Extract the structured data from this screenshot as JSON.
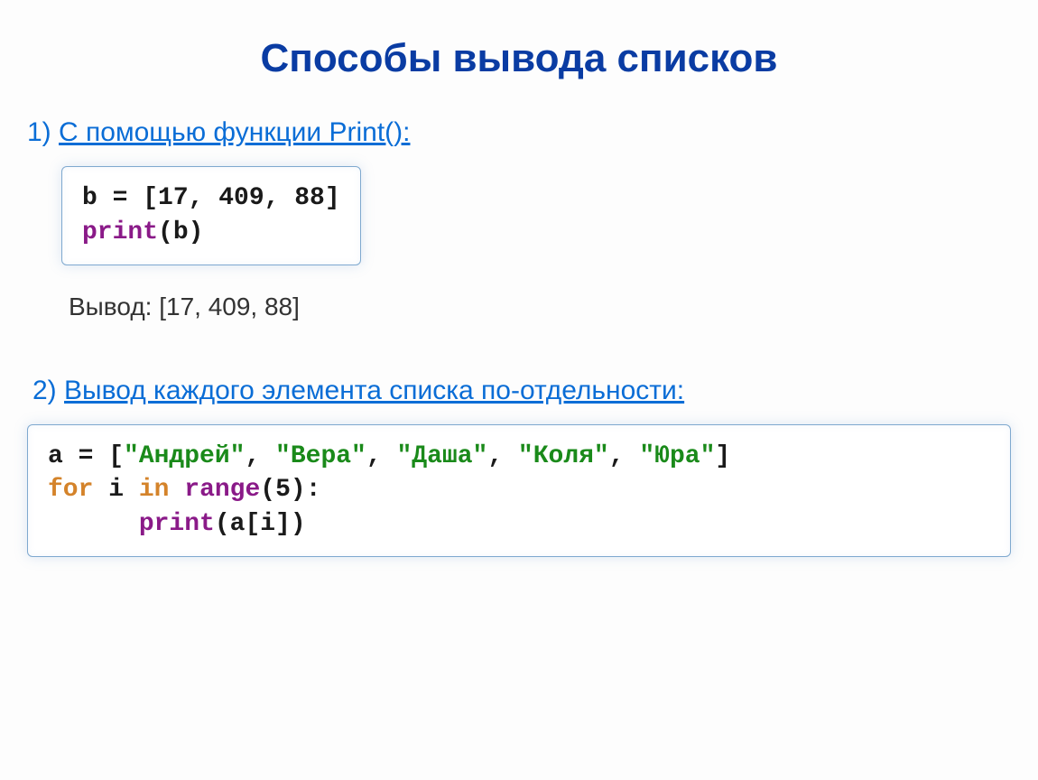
{
  "title": "Способы вывода списков",
  "section1": {
    "num": "1) ",
    "heading": "С помощью функции Print():",
    "code": {
      "line1": "b = [17, 409, 88]",
      "print_kw": "print",
      "args": "(b)"
    },
    "output_label": "Вывод: ",
    "output_value": "[17, 409, 88]"
  },
  "section2": {
    "num": "2) ",
    "heading": "Вывод каждого элемента списка по-отдельности:",
    "code": {
      "assign": "a = [",
      "s1": "\"Андрей\"",
      "c1": ", ",
      "s2": "\"Вера\"",
      "c2": ", ",
      "s3": "\"Даша\"",
      "c3": ", ",
      "s4": "\"Коля\"",
      "c4": ", ",
      "s5": "\"Юра\"",
      "close": "]",
      "for_kw": "for",
      "sp1": " i ",
      "in_kw": "in",
      "sp2": " ",
      "range_kw": "range",
      "range_args": "(5):",
      "indent": "      ",
      "print_kw": "print",
      "print_args": "(a[i])"
    }
  }
}
